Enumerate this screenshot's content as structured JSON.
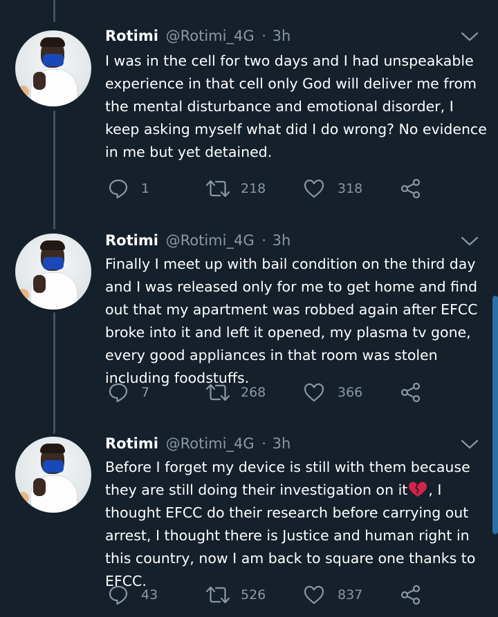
{
  "tweets": [
    {
      "name": "Rotimi",
      "handle": "@Rotimi_4G",
      "sep": "·",
      "time": "3h",
      "text": "I was in the cell for two days and I had unspeakable experience in that cell only God will deliver me from the mental disturbance and emotional disorder, I keep asking myself what did I do wrong? No evidence in me but yet detained.",
      "replies": "1",
      "retweets": "218",
      "likes": "318"
    },
    {
      "name": "Rotimi",
      "handle": "@Rotimi_4G",
      "sep": "·",
      "time": "3h",
      "text": "Finally I meet up with bail condition on the third day and I was released only for me to get home and find out that my apartment was robbed again after EFCC broke into it and left it opened, my plasma tv gone, every good appliances in that room was stolen including foodstuffs.",
      "replies": "7",
      "retweets": "268",
      "likes": "366"
    },
    {
      "name": "Rotimi",
      "handle": "@Rotimi_4G",
      "sep": "·",
      "time": "3h",
      "text_before_emoji": "Before I forget my device is still with them because they are still doing their investigation on it",
      "text_after_emoji": ", I thought EFCC do their research before carrying out arrest, I thought there is Justice and human right in this country, now I am back to square one thanks to EFCC.",
      "replies": "43",
      "retweets": "526",
      "likes": "837"
    }
  ],
  "icons": {
    "reply": "reply-icon",
    "retweet": "retweet-icon",
    "like": "like-icon",
    "share": "share-icon",
    "more": "chevron-down-icon",
    "emoji": "broken-heart-emoji"
  },
  "colors": {
    "background": "#15202b",
    "secondary_text": "#8899a6",
    "thread_line": "#3d5466",
    "scrollbar": "#2b6fa8",
    "broken_heart": "#d3234a"
  }
}
